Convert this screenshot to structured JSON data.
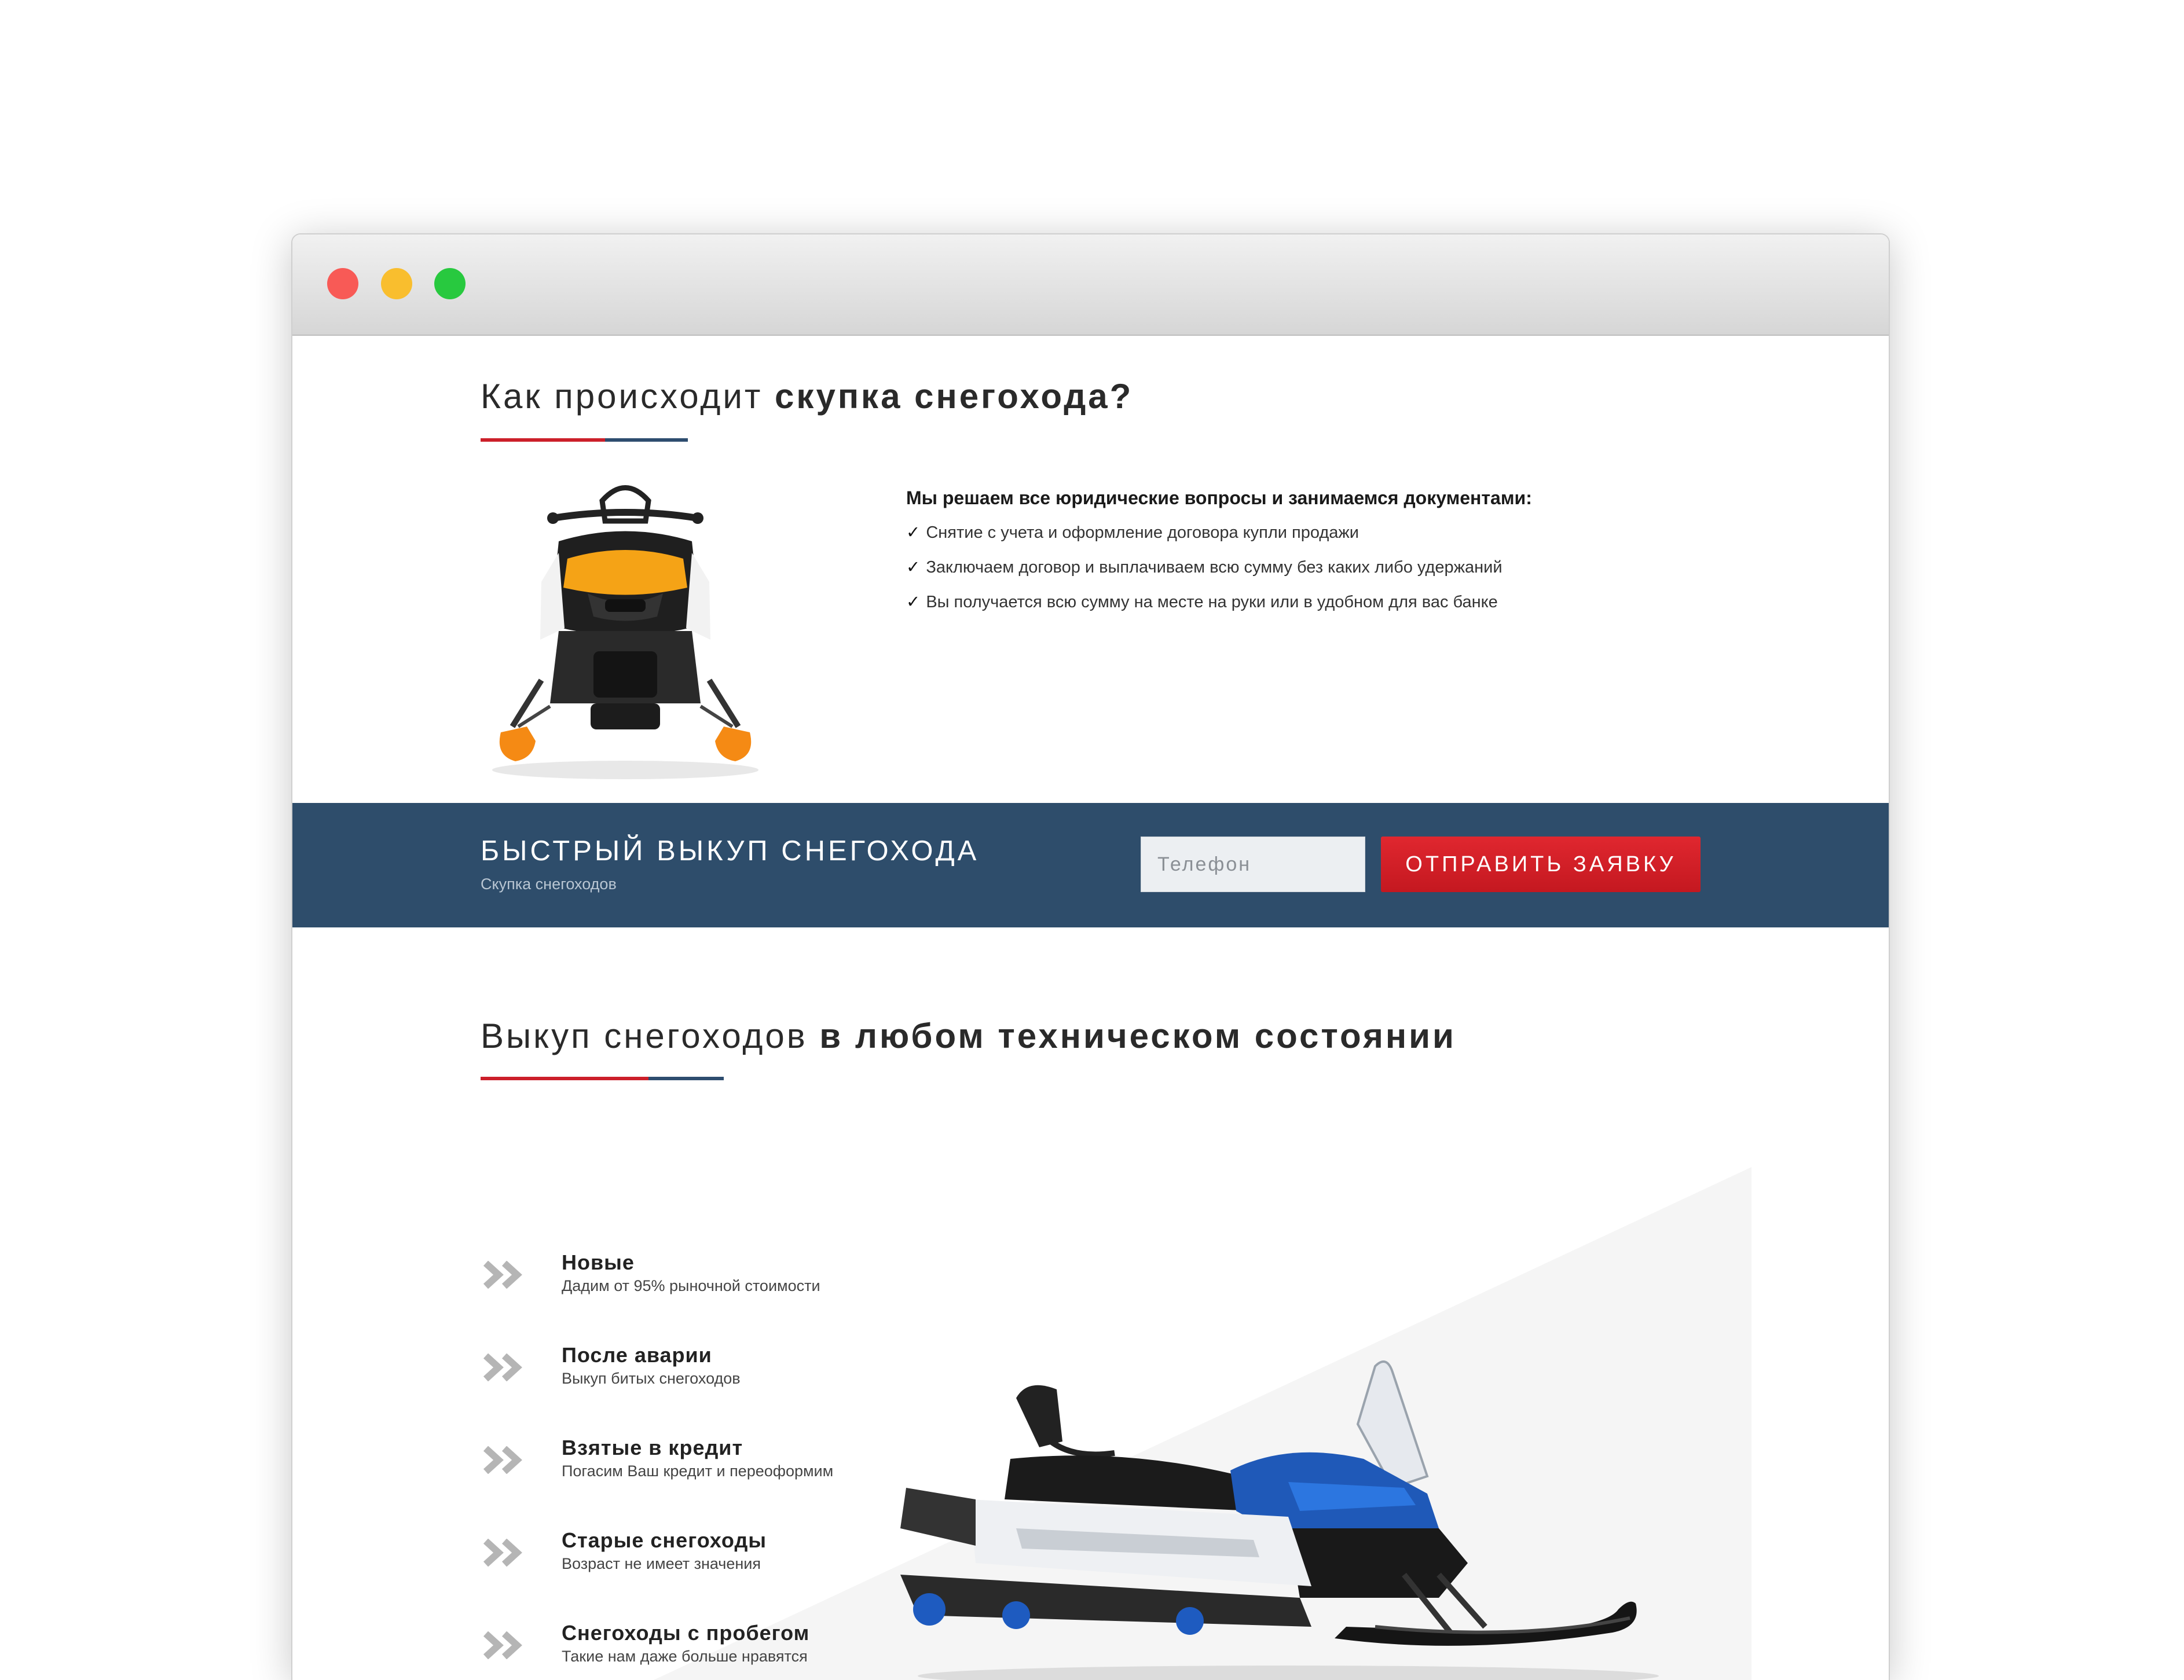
{
  "window": {
    "controls": [
      "close",
      "minimize",
      "maximize"
    ]
  },
  "section1": {
    "title_light": "Как происходит",
    "title_bold": "скупка снегохода?",
    "docs_title": "Мы решаем все юридические вопросы и занимаемся документами:",
    "check_mark": "✓",
    "items": [
      "Снятие с учета и оформление договора купли продажи",
      "Заключаем договор и выплачиваем всю сумму без каких либо удержаний",
      "Вы получается всю сумму на месте на руки или в удобном для вас банке"
    ]
  },
  "banner": {
    "title": "БЫСТРЫЙ ВЫКУП СНЕГОХОДА",
    "subtitle": "Скупка снегоходов",
    "phone_placeholder": "Телефон",
    "phone_value": "",
    "submit_label": "ОТПРАВИТЬ ЗАЯВКУ"
  },
  "section2": {
    "title_light": "Выкуп снегоходов",
    "title_bold": "в любом техническом состоянии",
    "features": [
      {
        "title": "Новые",
        "subtitle": "Дадим от 95% рыночной стоимости"
      },
      {
        "title": "После аварии",
        "subtitle": "Выкуп битых снегоходов"
      },
      {
        "title": "Взятые в кредит",
        "subtitle": "Погасим Ваш кредит и переоформим"
      },
      {
        "title": "Старые снегоходы",
        "subtitle": "Возраст не имеет значения"
      },
      {
        "title": "Снегоходы с пробегом",
        "subtitle": "Такие нам даже больше нравятся"
      }
    ]
  },
  "colors": {
    "accent_red": "#cc1f2a",
    "accent_blue": "#2e4d6f",
    "banner_bg": "#2e4d6b",
    "button_red": "#d42029"
  },
  "icons": [
    "snowmobile-orange-image",
    "snowmobile-blue-image",
    "double-chevron-icon"
  ]
}
